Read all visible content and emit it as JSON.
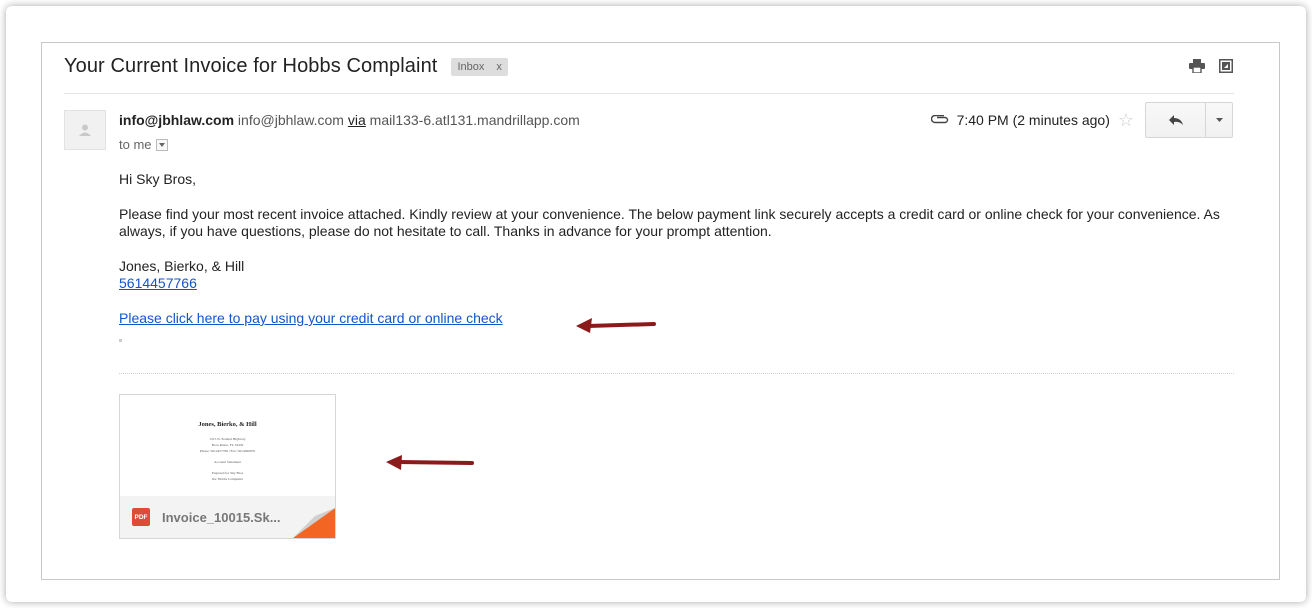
{
  "email": {
    "subject": "Your Current Invoice for Hobbs Complaint",
    "label_chip": "Inbox",
    "label_chip_remove": "x",
    "sender_name": "info@jbhlaw.com",
    "sender_email": "info@jbhlaw.com",
    "via_word": "via",
    "via_domain": "mail133-6.atl131.mandrillapp.com",
    "to_line": "to me",
    "timestamp": "7:40 PM (2 minutes ago)",
    "greeting": "Hi Sky Bros,",
    "body_paragraph": "Please find your most recent invoice attached. Kindly review at your convenience. The below payment link securely accepts a credit card or online check for your convenience. As always, if you have questions, please do not hesitate to call. Thanks in advance for your prompt attention.",
    "signature_name": "Jones, Bierko, & Hill",
    "signature_phone": "5614457766",
    "pay_link": "Please click here to pay using your credit card or online check"
  },
  "attachment": {
    "file_name": "Invoice_10015.Sk...",
    "badge": "PDF",
    "preview_title": "Jones, Bierko, & Hill",
    "preview_lines": [
      "1515 N. Federal Highway",
      "Boca Raton, FL 33432",
      "Phone: 5614457766  |  Fax: 5614360070",
      "Account Statement",
      "Prepared for Sky Bros",
      "Re: Hobbs Complaint"
    ]
  },
  "icons": {
    "print": "print-icon",
    "new_window": "new-window-icon",
    "attachment": "paperclip-icon",
    "star": "star-icon",
    "reply": "reply-icon",
    "more": "dropdown-arrow-icon"
  },
  "colors": {
    "link": "#1155cc",
    "arrow": "#8b1a1a",
    "pdf_badge": "#dd4b39",
    "corner_fold": "#f26522"
  }
}
